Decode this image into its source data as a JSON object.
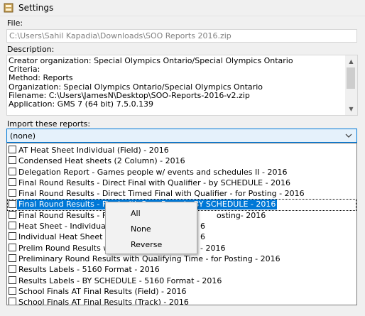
{
  "window": {
    "title": "Settings"
  },
  "file": {
    "label": "File:",
    "value": "C:\\Users\\Sahil Kapadia\\Downloads\\SOO Reports 2016.zip"
  },
  "description": {
    "label": "Description:",
    "lines": [
      "Creator organization: Special Olympics Ontario/Special Olympics Ontario",
      "Criteria:",
      "Method: Reports",
      "Organization: Special Olympics Ontario/Special Olympics Ontario",
      "Filename: C:\\Users\\JamesN\\Desktop\\SOO-Reports-2016-v2.zip",
      "Application: GMS 7 (64 bit) 7.5.0.139"
    ]
  },
  "reports": {
    "label": "Import these reports:",
    "selected": "(none)",
    "items": [
      "AT Heat Sheet Individual (Field) - 2016",
      "Condensed Heat sheets (2 Column) - 2016",
      "Delegation Report - Games people w/ events and schedules II - 2016",
      "Final Round Results - Direct Final with Qualifier - by SCHEDULE - 2016",
      "Final Round Results - Direct Timed Final with Qualifier - for Posting - 2016",
      "Final Round Results - Final with Prev Round - BY SCHEDULE - 2016",
      "Final Round Results - Final with Prev Round - for Posting- 2016",
      "Heat Sheet - Individual Timed Events - 2016",
      "Individual Heat Sheet & Score Sheet - 2016",
      "Prelim Round Results with Qualifying Time - 2016",
      "Preliminary Round Results with Qualifying Time - for Posting - 2016",
      "Results Labels - 5160 Format - 2016",
      "Results Labels - BY SCHEDULE - 5160 Format - 2016",
      "School Finals AT Final Results (Field) - 2016",
      "School Finals AT Final Results (Track) - 2016"
    ],
    "visible_texts": [
      "AT Heat Sheet Individual (Field) - 2016",
      "Condensed Heat sheets (2 Column) - 2016",
      "Delegation Report - Games people w/ events and schedules II - 2016",
      "Final Round Results - Direct Final with Qualifier - by SCHEDULE - 2016",
      "Final Round Results - Direct Timed Final with Qualifier - for Posting - 2016",
      "Final Round Results - Final with Prev Round - BY SCHEDULE - 2016",
      "Final Round Results - Fina",
      "Heat Sheet - Individual Ti",
      "Individual Heat Sheet & S",
      "Prelim Round Results with",
      "Preliminary Round Results with Qualifying Time - for Posting - 2016",
      "Results Labels - 5160 Format - 2016",
      "Results Labels - BY SCHEDULE - 5160 Format - 2016",
      "School Finals AT Final Results (Field) - 2016",
      "School Finals AT Final Results (Track) - 2016"
    ],
    "right_fragments": [
      "osting- 2016",
      "6",
      "6",
      "- 2016"
    ]
  },
  "context_menu": {
    "items": [
      "All",
      "None",
      "Reverse"
    ]
  },
  "colors": {
    "accent": "#0078d7",
    "combo_bg": "#e5f1fb"
  }
}
